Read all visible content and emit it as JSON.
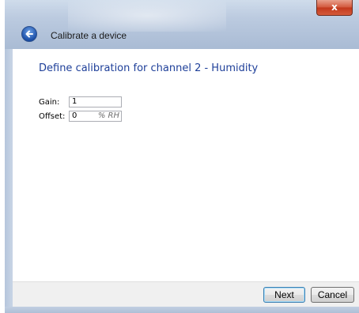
{
  "window": {
    "title": "Calibrate a device",
    "close_label": "x"
  },
  "page": {
    "heading": "Define calibration for channel 2 - Humidity"
  },
  "form": {
    "gain_label": "Gain:",
    "gain_value": "1",
    "offset_label": "Offset:",
    "offset_value": "0",
    "offset_unit": "% RH"
  },
  "buttons": {
    "next": "Next",
    "cancel": "Cancel"
  },
  "icons": {
    "back": "back-arrow-icon",
    "close": "close-icon"
  }
}
